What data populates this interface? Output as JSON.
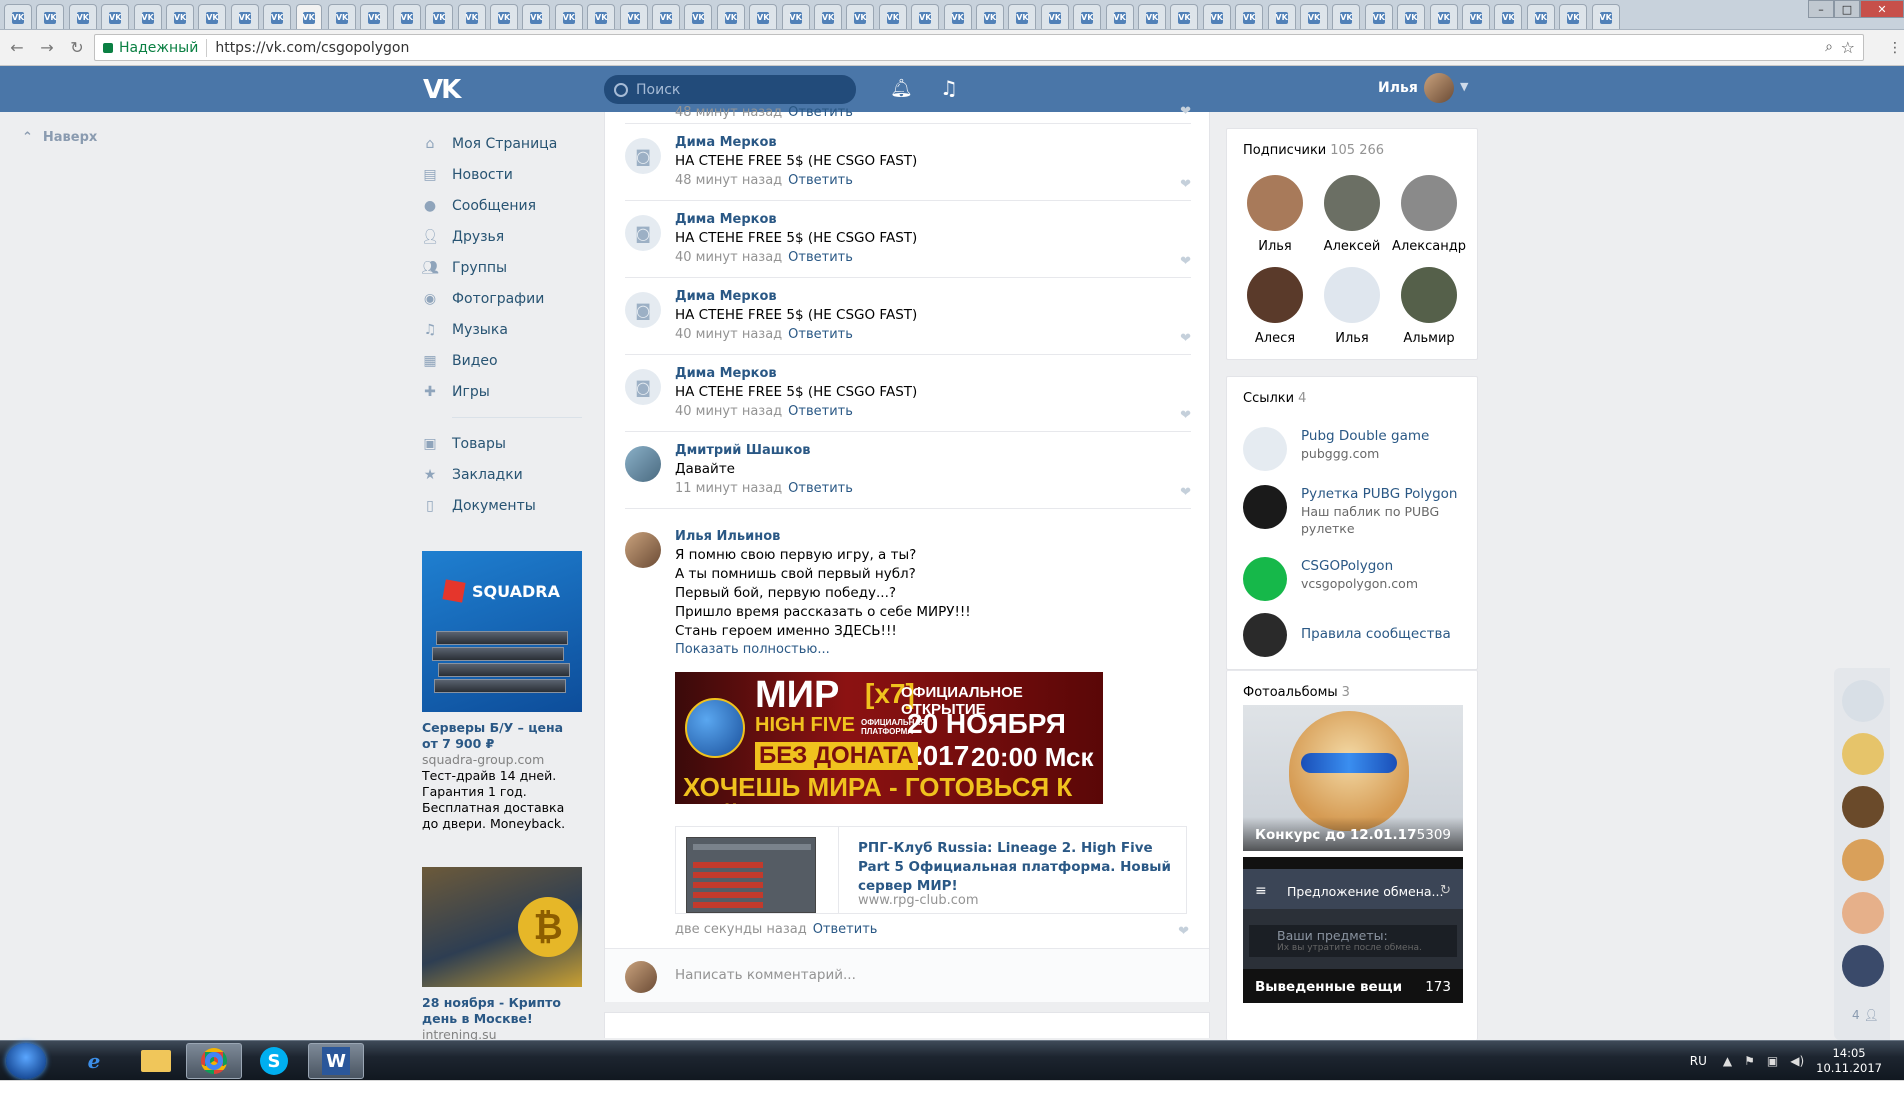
{
  "browser": {
    "tab_favicons": [
      "VK",
      "VK",
      "VK",
      "VK",
      "VK",
      "VK",
      "VK",
      "VK",
      "VK",
      "VK",
      "VK",
      "VK",
      "VK",
      "VK",
      "VK",
      "VK",
      "VK",
      "VK",
      "VK",
      "VK",
      "VK",
      "VK",
      "VK",
      "VK",
      "VK",
      "VK",
      "VK",
      "VK",
      "VK",
      "VK",
      "VK",
      "VK",
      "VK",
      "VK",
      "VK",
      "VK",
      "VK",
      "VK",
      "VK",
      "VK",
      "VK",
      "VK",
      "VK",
      "VK",
      "VK",
      "VK",
      "VK",
      "VK",
      "VK",
      "VK"
    ],
    "secure_label": "Надежный",
    "url": "https://vk.com/csgopolygon"
  },
  "header": {
    "logo": "VK",
    "search_placeholder": "Поиск",
    "user_name": "Илья"
  },
  "left": {
    "to_top": "Наверх",
    "menu": [
      {
        "label": "Моя Страница",
        "icon": "home-icon"
      },
      {
        "label": "Новости",
        "icon": "news-icon"
      },
      {
        "label": "Сообщения",
        "icon": "messages-icon"
      },
      {
        "label": "Друзья",
        "icon": "friends-icon"
      },
      {
        "label": "Группы",
        "icon": "groups-icon"
      },
      {
        "label": "Фотографии",
        "icon": "camera-icon"
      },
      {
        "label": "Музыка",
        "icon": "music-icon"
      },
      {
        "label": "Видео",
        "icon": "video-icon"
      },
      {
        "label": "Игры",
        "icon": "gamepad-icon"
      }
    ],
    "menu2": [
      {
        "label": "Товары",
        "icon": "bag-icon"
      },
      {
        "label": "Закладки",
        "icon": "star-icon"
      },
      {
        "label": "Документы",
        "icon": "document-icon"
      }
    ],
    "ad1": {
      "brand": "SQUADRA",
      "title": "Серверы Б/У – цена от 7 900 ₽",
      "domain": "squadra-group.com",
      "text": "Тест-драйв 14 дней. Гарантия 1 год. Бесплатная доставка до двери. Moneyback."
    },
    "ad2": {
      "title": "28 ноября - Крипто день в Москве!",
      "domain": "intrening.su"
    }
  },
  "feed": {
    "top_partial": {
      "time": "48 минут назад",
      "reply": "Ответить"
    },
    "comments": [
      {
        "name": "Дима Мерков",
        "text": "НА СТЕНЕ FREE 5$ (НЕ CSGO FAST)",
        "time": "48 минут назад",
        "reply": "Ответить"
      },
      {
        "name": "Дима Мерков",
        "text": "НА СТЕНЕ FREE 5$ (НЕ CSGO FAST)",
        "time": "40 минут назад",
        "reply": "Ответить"
      },
      {
        "name": "Дима Мерков",
        "text": "НА СТЕНЕ FREE 5$ (НЕ CSGO FAST)",
        "time": "40 минут назад",
        "reply": "Ответить"
      },
      {
        "name": "Дима Мерков",
        "text": "НА СТЕНЕ FREE 5$ (НЕ CSGO FAST)",
        "time": "40 минут назад",
        "reply": "Ответить"
      },
      {
        "name": "Дмитрий Шашков",
        "text": "Давайте",
        "time": "11 минут назад",
        "reply": "Ответить"
      }
    ],
    "big_comment": {
      "name": "Илья Ильинов",
      "lines": [
        "Я помню свою первую игру, а ты?",
        "А ты помнишь свой первый нубл?",
        "Первый бой, первую победу...?",
        "Пришло время рассказать о себе МИРУ!!!",
        "Стань героем именно ЗДЕСЬ!!!"
      ],
      "show_more": "Показать полностью...",
      "banner": {
        "mir": "МИР",
        "x7": "[x7]",
        "high_five": "HIGH FIVE",
        "platform": "ОФИЦИАЛЬНАЯ ПЛАТФОРМА",
        "opening": "ОФИЦИАЛЬНОЕ ОТКРЫТИЕ",
        "date": "20 НОЯБРЯ 2017",
        "no_donate": "БЕЗ ДОНАТА",
        "time": "20:00 Мск",
        "slogan": "ХОЧЕШЬ МИРА - ГОТОВЬСЯ К ВОЙНЕ"
      },
      "link_title": "РПГ-Клуб Russia: Lineage 2. High Five Part 5 Официальная платформа. Новый сервер МИР!",
      "link_url": "www.rpg-club.com",
      "time": "две секунды назад",
      "reply": "Ответить"
    },
    "write_placeholder": "Написать комментарий..."
  },
  "right": {
    "subscribers": {
      "title": "Подписчики",
      "count": "105 266",
      "people": [
        {
          "name": "Илья",
          "color": "#a87a5a"
        },
        {
          "name": "Алексей",
          "color": "#6b6f64"
        },
        {
          "name": "Александр",
          "color": "#8a8a8a"
        },
        {
          "name": "Алеся",
          "color": "#5a3a2a"
        },
        {
          "name": "Илья",
          "color": "#dfe6ee"
        },
        {
          "name": "Альмир",
          "color": "#55604a"
        }
      ]
    },
    "links": {
      "title": "Ссылки",
      "count": "4",
      "items": [
        {
          "title": "Pubg Double game",
          "desc": "pubggg.com",
          "color": "#e5ebf1"
        },
        {
          "title": "Рулетка PUBG Polygon",
          "desc": "Наш паблик по PUBG рулетке",
          "color": "#1a1a1a"
        },
        {
          "title": "CSGOPolygon",
          "desc": "vcsgopolygon.com",
          "color": "#16b84a"
        },
        {
          "title": "Правила сообщества",
          "desc": "",
          "color": "#2a2a2a"
        }
      ]
    },
    "albums": {
      "title": "Фотоальбомы",
      "count": "3",
      "items": [
        {
          "title": "Конкурс до 12.01.17",
          "count": "5309"
        },
        {
          "title": "Выведенные вещи",
          "count": "173",
          "phone_title": "Предложение обмена...",
          "item_label": "Ваши предметы:",
          "item_sub": "Их вы утратите после обмена."
        }
      ]
    }
  },
  "dock": {
    "avatars": [
      "#d8dfe6",
      "#e6c46a",
      "#6a4a2a",
      "#d9a05a",
      "#e6b08a",
      "#3a4a6a"
    ],
    "count": "4"
  },
  "taskbar": {
    "lang": "RU",
    "time": "14:05",
    "date": "10.11.2017"
  }
}
